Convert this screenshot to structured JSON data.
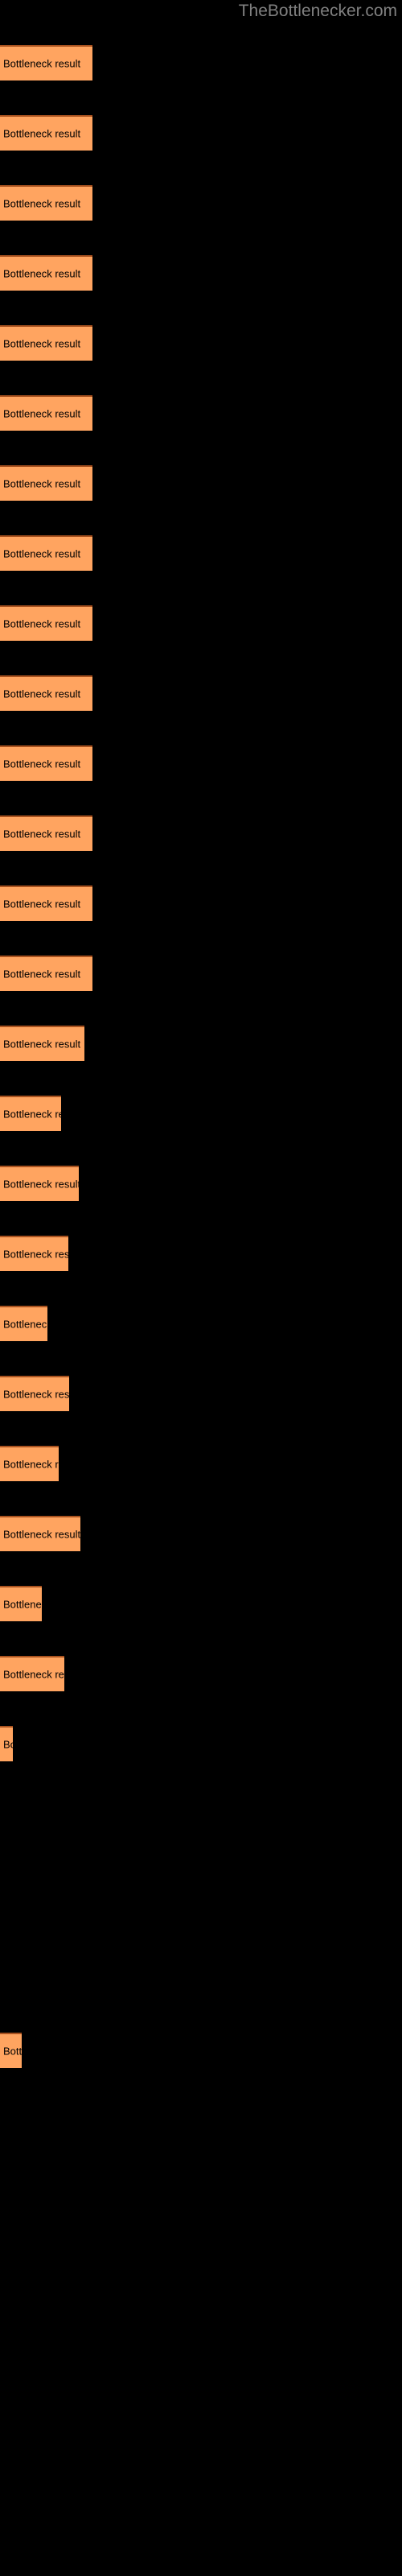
{
  "site": {
    "watermark": "TheBottlenecker.com"
  },
  "colors": {
    "background": "#000000",
    "bar_fill": "#FFA460",
    "bar_border_top": "#A9521F",
    "label_text": "#000000",
    "watermark_text": "#808080"
  },
  "chart_data": {
    "type": "bar",
    "orientation": "horizontal",
    "title": "",
    "subtitle": "",
    "xlabel": "",
    "ylabel": "",
    "grid": false,
    "legend": null,
    "bar_label_text": "Bottleneck result",
    "categories": [
      "Bottleneck result",
      "Bottleneck result",
      "Bottleneck result",
      "Bottleneck result",
      "Bottleneck result",
      "Bottleneck result",
      "Bottleneck result",
      "Bottleneck result",
      "Bottleneck result",
      "Bottleneck result",
      "Bottleneck result",
      "Bottleneck result",
      "Bottleneck result",
      "Bottleneck result",
      "Bottleneck result",
      "Bottleneck result",
      "Bottleneck result",
      "Bottleneck result",
      "Bottleneck result",
      "Bottleneck result",
      "Bottleneck result",
      "Bottleneck result",
      "Bottleneck result",
      "Bottleneck result",
      "Bottleneck result",
      "Bottleneck result"
    ],
    "values": [
      115,
      115,
      115,
      115,
      115,
      115,
      115,
      115,
      115,
      115,
      115,
      115,
      115,
      115,
      105,
      76,
      98,
      85,
      59,
      86,
      73,
      100,
      52,
      80,
      16,
      27
    ],
    "xlim": [
      0,
      500
    ],
    "bars": [
      {
        "label": "Bottleneck result",
        "value": 115,
        "top": 56,
        "width": 115
      },
      {
        "label": "Bottleneck result",
        "value": 115,
        "top": 143,
        "width": 115
      },
      {
        "label": "Bottleneck result",
        "value": 115,
        "top": 230,
        "width": 115
      },
      {
        "label": "Bottleneck result",
        "value": 115,
        "top": 317,
        "width": 115
      },
      {
        "label": "Bottleneck result",
        "value": 115,
        "top": 404,
        "width": 115
      },
      {
        "label": "Bottleneck result",
        "value": 115,
        "top": 491,
        "width": 115
      },
      {
        "label": "Bottleneck result",
        "value": 115,
        "top": 578,
        "width": 115
      },
      {
        "label": "Bottleneck result",
        "value": 115,
        "top": 665,
        "width": 115
      },
      {
        "label": "Bottleneck result",
        "value": 115,
        "top": 752,
        "width": 115
      },
      {
        "label": "Bottleneck result",
        "value": 115,
        "top": 839,
        "width": 115
      },
      {
        "label": "Bottleneck result",
        "value": 115,
        "top": 926,
        "width": 115
      },
      {
        "label": "Bottleneck result",
        "value": 115,
        "top": 1013,
        "width": 115
      },
      {
        "label": "Bottleneck result",
        "value": 115,
        "top": 1100,
        "width": 115
      },
      {
        "label": "Bottleneck result",
        "value": 115,
        "top": 1187,
        "width": 115
      },
      {
        "label": "Bottleneck result",
        "value": 105,
        "top": 1274,
        "width": 105
      },
      {
        "label": "Bottleneck result",
        "value": 76,
        "top": 1361,
        "width": 76
      },
      {
        "label": "Bottleneck result",
        "value": 98,
        "top": 1448,
        "width": 98
      },
      {
        "label": "Bottleneck result",
        "value": 85,
        "top": 1535,
        "width": 85
      },
      {
        "label": "Bottleneck result",
        "value": 59,
        "top": 1622,
        "width": 59
      },
      {
        "label": "Bottleneck result",
        "value": 86,
        "top": 1709,
        "width": 86
      },
      {
        "label": "Bottleneck result",
        "value": 73,
        "top": 1796,
        "width": 73
      },
      {
        "label": "Bottleneck result",
        "value": 100,
        "top": 1883,
        "width": 100
      },
      {
        "label": "Bottleneck result",
        "value": 52,
        "top": 1970,
        "width": 52
      },
      {
        "label": "Bottleneck result",
        "value": 80,
        "top": 2057,
        "width": 80
      },
      {
        "label": "Bottleneck result",
        "value": 16,
        "top": 2144,
        "width": 16
      },
      {
        "label": "Bottleneck result",
        "value": 27,
        "top": 2525,
        "width": 27
      }
    ]
  }
}
